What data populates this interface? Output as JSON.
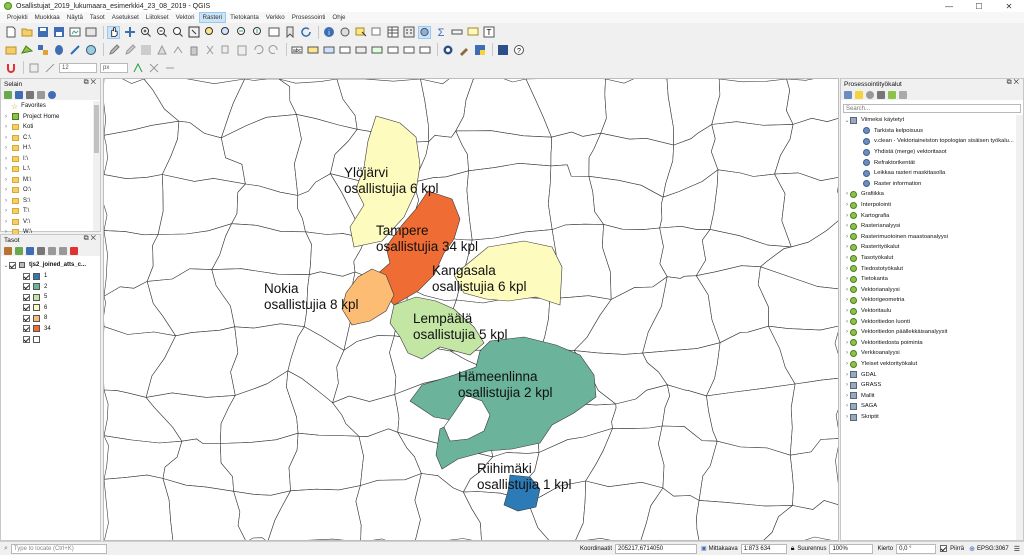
{
  "window": {
    "title": "Osallistujat_2019_lukumaara_esimerkki4_23_08_2019 - QGIS",
    "min": "—",
    "max": "☐",
    "close": "✕"
  },
  "menu": [
    "Projekti",
    "Muokkaa",
    "Näytä",
    "Tasot",
    "Asetukset",
    "Liitokset",
    "Vektori",
    "Rasteri",
    "Tietokanta",
    "Verkko",
    "Prosessointi",
    "Ohje"
  ],
  "toolbar": {
    "snap_value": "12",
    "snap_unit": "px"
  },
  "browser": {
    "title": "Selain",
    "items": [
      {
        "label": "Favorites",
        "icon": "star-icon"
      },
      {
        "label": "Project Home",
        "icon": "project-home-icon"
      },
      {
        "label": "Koti",
        "icon": "folder-icon"
      },
      {
        "label": "C:\\",
        "icon": "folder-icon"
      },
      {
        "label": "H:\\",
        "icon": "folder-icon"
      },
      {
        "label": "I:\\",
        "icon": "folder-icon"
      },
      {
        "label": "L:\\",
        "icon": "folder-icon"
      },
      {
        "label": "M:\\",
        "icon": "folder-icon"
      },
      {
        "label": "O:\\",
        "icon": "folder-icon"
      },
      {
        "label": "S:\\",
        "icon": "folder-icon"
      },
      {
        "label": "T:\\",
        "icon": "folder-icon"
      },
      {
        "label": "V:\\",
        "icon": "folder-icon"
      },
      {
        "label": "W:\\",
        "icon": "folder-icon"
      }
    ]
  },
  "layers": {
    "title": "Tasot",
    "layer_name": "tjs2_joined_atts_c...",
    "legend": [
      {
        "label": "1",
        "color": "#2c7bb6"
      },
      {
        "label": "2",
        "color": "#6bb39b"
      },
      {
        "label": "5",
        "color": "#c4e6a5"
      },
      {
        "label": "6",
        "color": "#fdfbbd"
      },
      {
        "label": "8",
        "color": "#fdbc74"
      },
      {
        "label": "34",
        "color": "#ef6d35"
      },
      {
        "label": "",
        "color": "#ffffff"
      }
    ]
  },
  "processing": {
    "title": "Prosessointityökalut",
    "search_placeholder": "Search...",
    "recent_label": "Viimeksi käytetyt",
    "recent": [
      "Tarkista kelpoisuus",
      "v.clean - Vektoriaineiston topologian sisäisen työkalu...",
      "Yhdistä (merge) vektoritasot",
      "Refraktorikentät",
      "Leikkaa rasteri maskitasolla",
      "Raster information"
    ],
    "groups": [
      "Grafiikka",
      "Interpolointi",
      "Kartografia",
      "Rasterianalyysi",
      "Rasterimuotoinen maastoanalyysi",
      "Rasterityökalut",
      "Tasotyökalut",
      "Tiedostotyökalut",
      "Tietokanta",
      "Vektorianalyysi",
      "Vektorigeometria",
      "Vektoritaulu",
      "Vektoritiedon luonti",
      "Vektoritiedon päällekkäisanalyysit",
      "Vektoritiedosta poiminta",
      "Verkkoanalyysi",
      "Yleiset vektorityökalut"
    ],
    "providers": [
      {
        "label": "GDAL",
        "icon": "gdal-icon"
      },
      {
        "label": "GRASS",
        "icon": "grass-icon"
      },
      {
        "label": "Mallit",
        "icon": "models-icon"
      },
      {
        "label": "SAGA",
        "icon": "saga-icon"
      },
      {
        "label": "Skriptit",
        "icon": "scripts-icon"
      }
    ]
  },
  "map": {
    "labels": [
      {
        "line1": "Ylöjärvi",
        "line2": "osallistujia 6 kpl"
      },
      {
        "line1": "Tampere",
        "line2": "osallistujia 34 kpl"
      },
      {
        "line1": "Kangasala",
        "line2": "osallistujia 6 kpl"
      },
      {
        "line1": "Nokia",
        "line2": "osallistujia 8 kpl"
      },
      {
        "line1": "Lempäälä",
        "line2": "osallistujia 5 kpl"
      },
      {
        "line1": "Hämeenlinna",
        "line2": "osallistujia 2 kpl"
      },
      {
        "line1": "Riihimäki",
        "line2": "osallistujia 1 kpl"
      }
    ]
  },
  "status": {
    "locate_placeholder": "Type to locate (Ctrl+K)",
    "coord_label": "Koordinaatit",
    "coord_value": "205217,6714050",
    "scale_label": "Mittakaava",
    "scale_value": "1:873 634",
    "mag_label": "Suurennus",
    "mag_value": "100%",
    "rot_label": "Kierto",
    "rot_value": "0,0 °",
    "render_label": "Piirrä",
    "crs": "EPSG:3067"
  }
}
